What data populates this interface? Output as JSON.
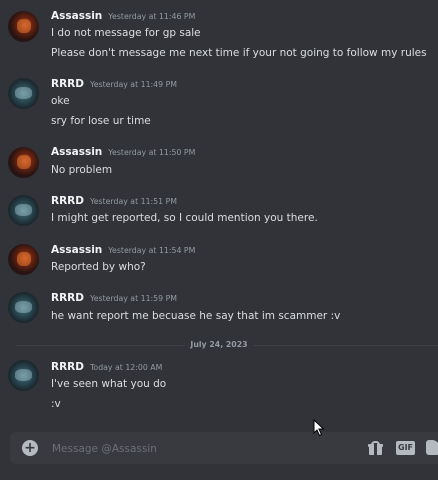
{
  "messages": [
    {
      "author": "Assassin",
      "avatar": "assassin-avatar",
      "timestamp": "Yesterday at 11:46 PM",
      "lines": [
        "I do not message for gp sale",
        "Please don't message me next time if your not going to follow my rules"
      ]
    },
    {
      "author": "RRRD",
      "avatar": "rrrd-avatar",
      "timestamp": "Yesterday at 11:49 PM",
      "lines": [
        "oke",
        "sry for lose ur time"
      ]
    },
    {
      "author": "Assassin",
      "avatar": "assassin-avatar",
      "timestamp": "Yesterday at 11:50 PM",
      "lines": [
        "No problem"
      ]
    },
    {
      "author": "RRRD",
      "avatar": "rrrd-avatar",
      "timestamp": "Yesterday at 11:51 PM",
      "lines": [
        "I might get reported, so I could mention you there."
      ]
    },
    {
      "author": "Assassin",
      "avatar": "assassin-avatar",
      "timestamp": "Yesterday at 11:54 PM",
      "lines": [
        "Reported by who?"
      ]
    },
    {
      "author": "RRRD",
      "avatar": "rrrd-avatar",
      "timestamp": "Yesterday at 11:59 PM",
      "lines": [
        "he want report me becuase he say that im scammer :v"
      ]
    },
    {
      "author": "RRRD",
      "avatar": "rrrd-avatar",
      "timestamp": "Today at 12:00 AM",
      "lines": [
        "I've seen what you do",
        ":v"
      ]
    }
  ],
  "date_divider": "July 24, 2023",
  "composer": {
    "placeholder": "Message @Assassin",
    "add_icon": "plus-circle-icon",
    "gift_icon": "gift-icon",
    "gif_label": "GIF",
    "sticker_icon": "sticker-icon"
  },
  "colors": {
    "background": "#313338",
    "composer": "#383a40",
    "author": "#f2f3f5",
    "timestamp": "#949ba4",
    "text": "#dbdee1"
  }
}
